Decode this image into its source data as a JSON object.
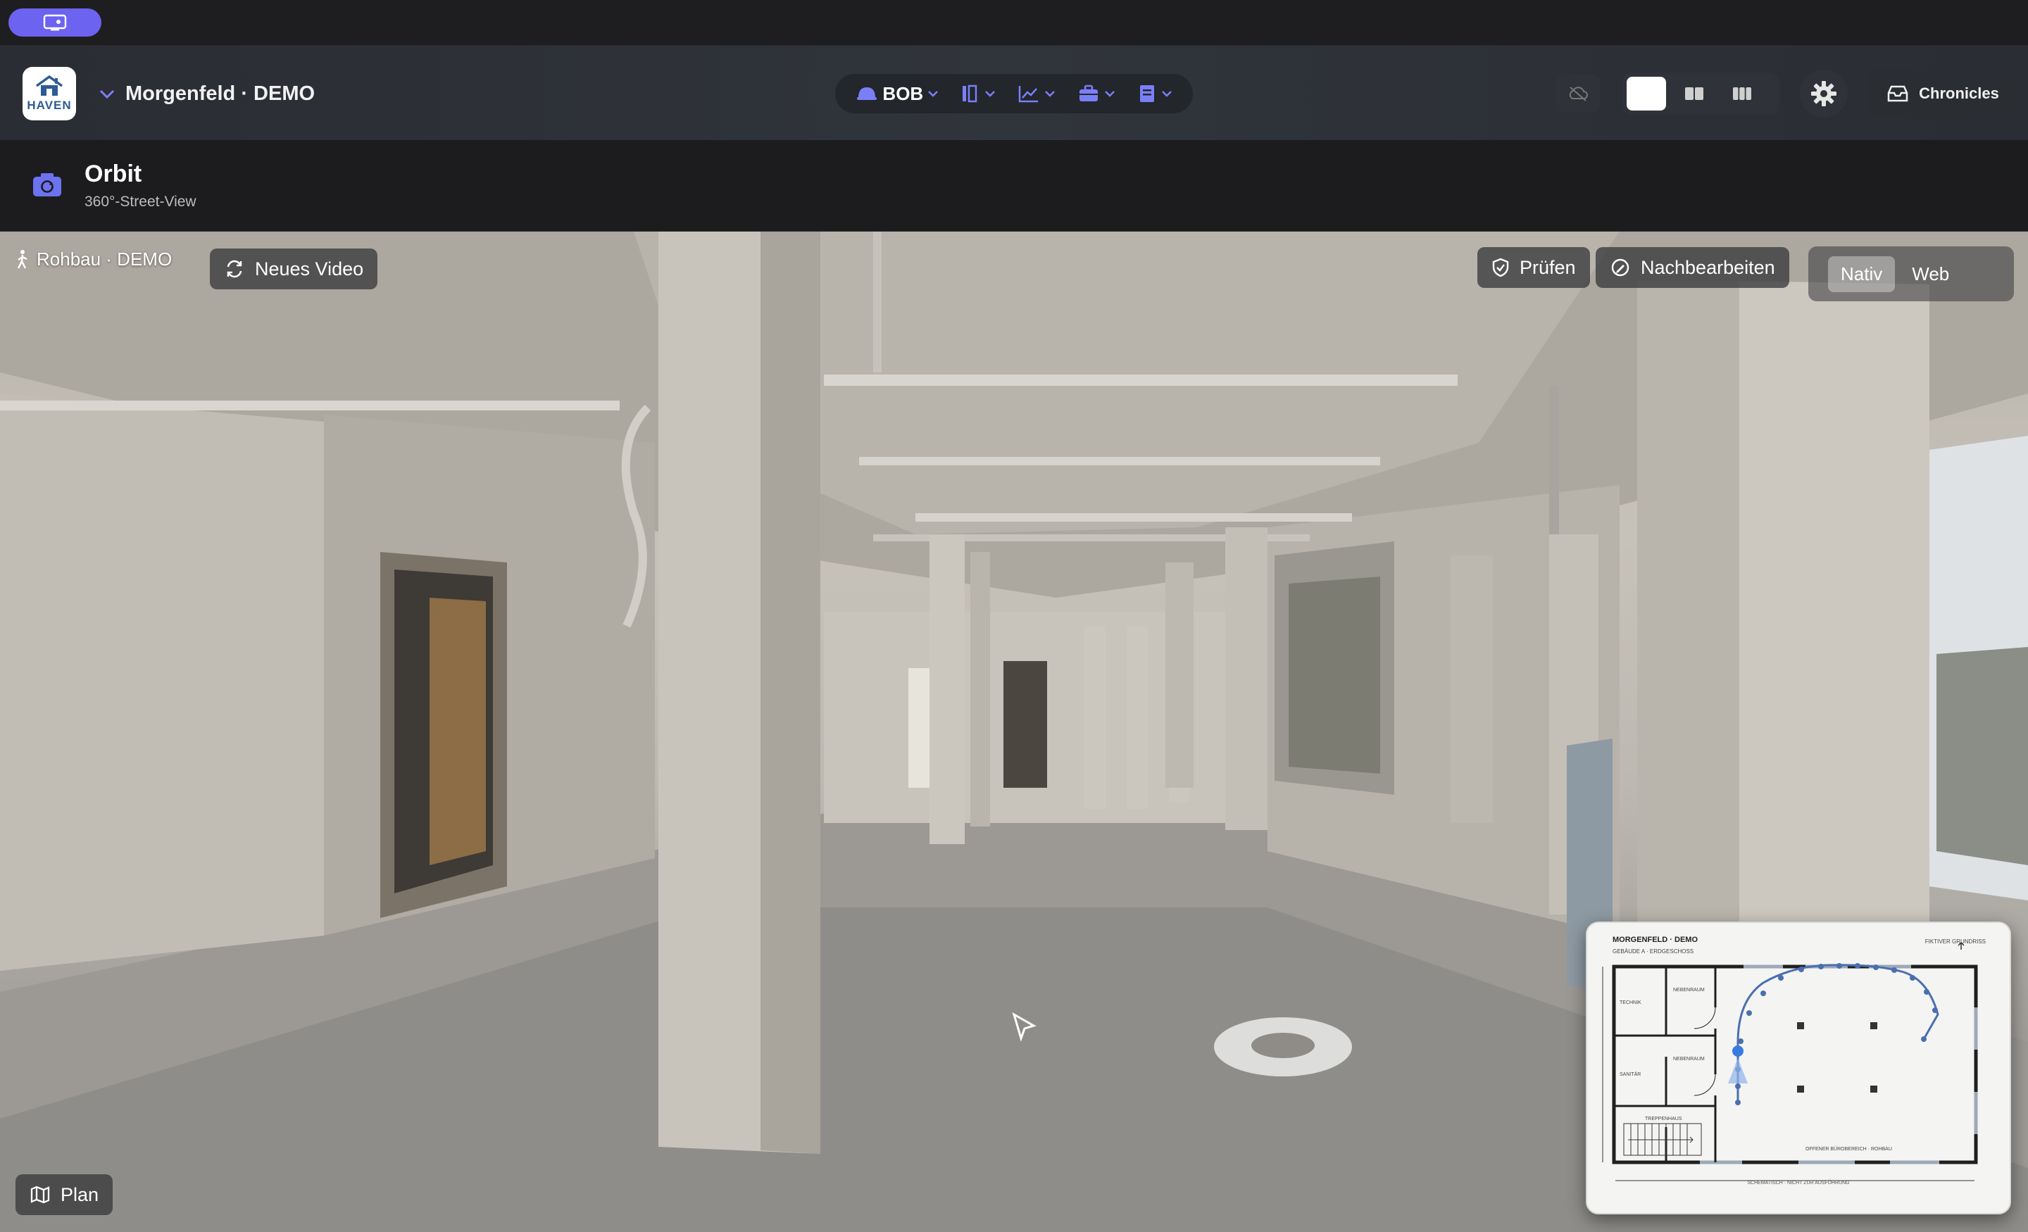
{
  "project": {
    "name": "Morgenfeld · DEMO"
  },
  "logo": {
    "text": "HAVEN"
  },
  "toolbar": {
    "bob_label": "BOB",
    "chronicles_label": "Chronicles"
  },
  "section": {
    "title": "Orbit",
    "subtitle": "360°-Street-View"
  },
  "viewer": {
    "location": "Rohbau · DEMO",
    "new_video_label": "Neues Video",
    "pruefen_label": "Prüfen",
    "nachbearbeiten_label": "Nachbearbeiten",
    "mode_native": "Nativ",
    "mode_web": "Web",
    "active_mode": "Nativ",
    "plan_label": "Plan"
  },
  "minimap": {
    "title": "MORGENFELD · DEMO",
    "subtitle": "GEBÄUDE A · ERDGESCHOSS",
    "corner": "FIKTIVER GRUNDRISS",
    "rooms": [
      "TECHNIK",
      "NEBENRAUM",
      "SANITÄR",
      "NEBENRAUM",
      "TREPPENHAUS"
    ],
    "area_label": "OFFENER BÜROBEREICH · ROHBAU",
    "footer": "SCHEMATISCH · NICHT ZUR AUSFÜHRUNG"
  },
  "colors": {
    "accent": "#7b7ff7",
    "pill": "#6c63f0",
    "route": "#4a6fb0"
  }
}
